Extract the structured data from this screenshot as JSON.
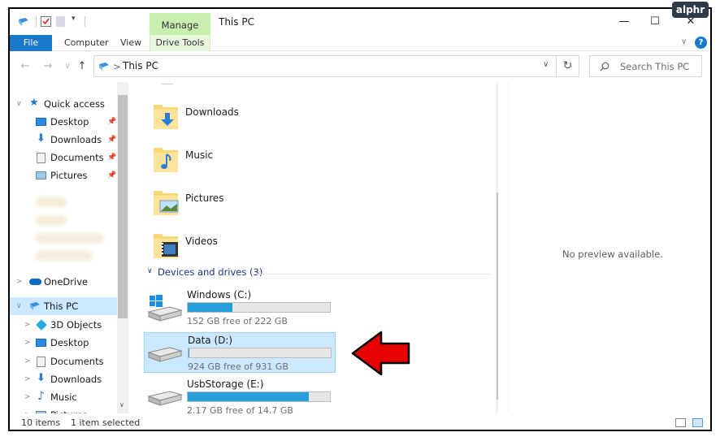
{
  "window": {
    "title": "This PC",
    "manage_tab": "Manage"
  },
  "ribbon": {
    "file": "File",
    "computer": "Computer",
    "view": "View",
    "drive_tools": "Drive Tools"
  },
  "window_buttons": {
    "minimize": "—",
    "maximize": "☐",
    "close": "✕"
  },
  "address": {
    "path": "This PC",
    "separator": ">"
  },
  "search": {
    "placeholder": "Search This PC"
  },
  "nav": {
    "quick_access": "Quick access",
    "quick_items": [
      "Desktop",
      "Downloads",
      "Documents",
      "Pictures"
    ],
    "onedrive": "OneDrive",
    "this_pc": "This PC",
    "pc_items": [
      "3D Objects",
      "Desktop",
      "Documents",
      "Downloads",
      "Music",
      "Pictures"
    ]
  },
  "folders": [
    "Downloads",
    "Music",
    "Pictures",
    "Videos"
  ],
  "devices": {
    "header": "Devices and drives (3)"
  },
  "drives": [
    {
      "name": "Windows (C:)",
      "free": "152 GB free of 222 GB",
      "used_fraction": 0.315
    },
    {
      "name": "Data (D:)",
      "free": "924 GB free of 931 GB",
      "used_fraction": 0.008
    },
    {
      "name": "UsbStorage (E:)",
      "free": "2.17 GB free of 14.7 GB",
      "used_fraction": 0.852
    }
  ],
  "preview": {
    "text": "No preview available."
  },
  "status": {
    "items": "10 items",
    "selected": "1 item selected"
  },
  "logo": {
    "text": "alphr"
  },
  "colors": {
    "accent": "#1979ca",
    "selection": "#cce8ff",
    "bar_fill": "#26a0da",
    "manage_tab": "#c6efb0",
    "arrow": "#e60000"
  }
}
